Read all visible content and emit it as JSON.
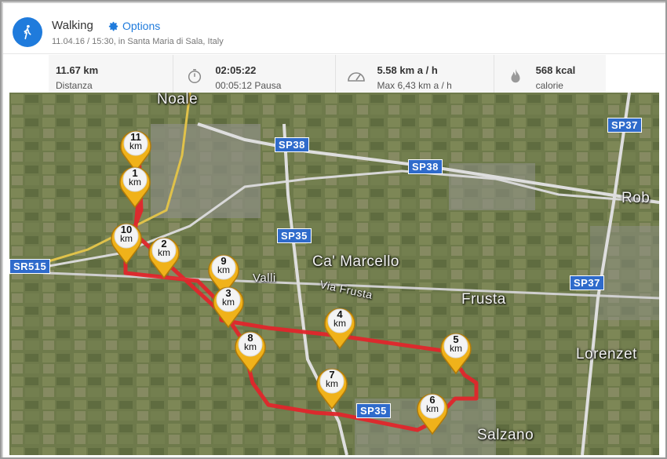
{
  "header": {
    "activity": "Walking",
    "options_label": "Options",
    "subtitle": "11.04.16 / 15:30, in Santa Maria di Sala, Italy"
  },
  "stats": [
    {
      "value": "11.67 km",
      "label": "Distanza",
      "icon": ""
    },
    {
      "value": "02:05:22",
      "label": "00:05:12 Pausa",
      "icon": "stopwatch-icon"
    },
    {
      "value": "5.58 km a / h",
      "label": "Max 6,43 km a / h",
      "icon": "speedometer-icon"
    },
    {
      "value": "568 kcal",
      "label": "calorie",
      "icon": "flame-icon"
    }
  ],
  "map": {
    "places": [
      "Noale",
      "Ca' Marcello",
      "Frusta",
      "Lorenzet",
      "Salzano",
      "Rob",
      "Valli",
      "Via Frusta"
    ],
    "roads": [
      "SP37",
      "SP38",
      "SP38",
      "SP35",
      "SR515",
      "SP37",
      "SP35"
    ],
    "markers": [
      {
        "num": "11",
        "unit": "km"
      },
      {
        "num": "1",
        "unit": "km"
      },
      {
        "num": "10",
        "unit": "km"
      },
      {
        "num": "2",
        "unit": "km"
      },
      {
        "num": "9",
        "unit": "km"
      },
      {
        "num": "3",
        "unit": "km"
      },
      {
        "num": "4",
        "unit": "km"
      },
      {
        "num": "8",
        "unit": "km"
      },
      {
        "num": "5",
        "unit": "km"
      },
      {
        "num": "7",
        "unit": "km"
      },
      {
        "num": "6",
        "unit": "km"
      }
    ]
  },
  "colors": {
    "accent": "#1f7bdc",
    "route": "#e0262b",
    "marker": "#f0b21a",
    "road_badge": "#2f6bcb"
  }
}
